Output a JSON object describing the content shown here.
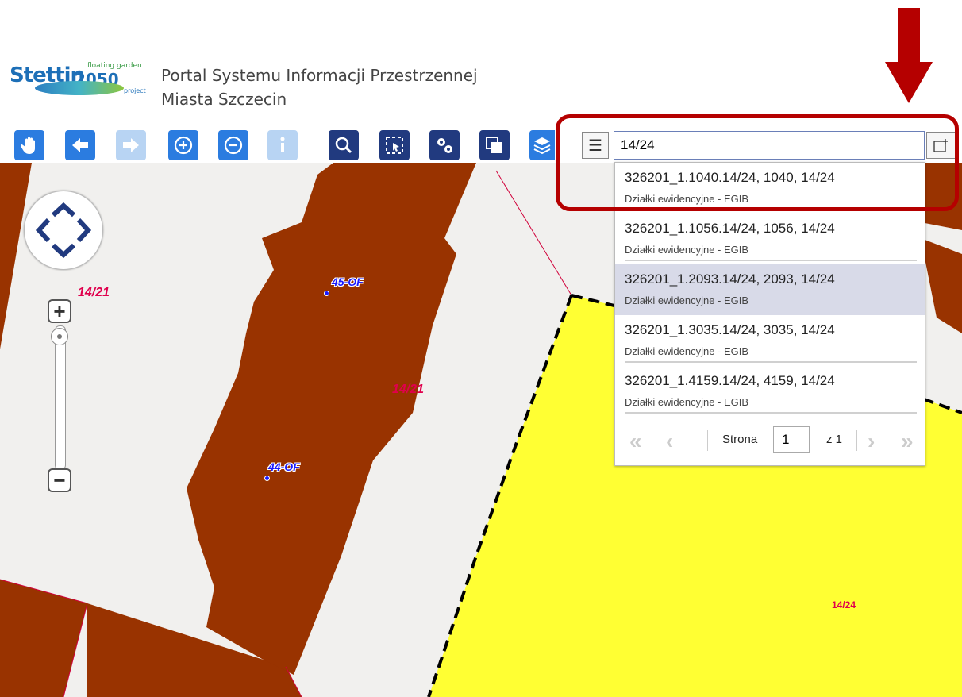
{
  "header": {
    "logo": {
      "name": "Stettin 2050",
      "text": "Stettin",
      "year": "2050",
      "tagline_top": "floating garden",
      "tagline_bottom": "project"
    },
    "title_line1": "Portal Systemu Informacji Przestrzennej",
    "title_line2": "Miasta Szczecin"
  },
  "toolbar": {
    "buttons": [
      {
        "name": "pan",
        "icon": "hand-icon"
      },
      {
        "name": "back",
        "icon": "arrow-left-icon"
      },
      {
        "name": "forward",
        "icon": "arrow-right-icon",
        "disabled": true
      },
      {
        "name": "zoom-in",
        "icon": "zoom-in-icon"
      },
      {
        "name": "zoom-out",
        "icon": "zoom-out-icon"
      },
      {
        "name": "info",
        "icon": "info-icon",
        "disabled": true
      },
      {
        "name": "search",
        "icon": "search-icon"
      },
      {
        "name": "select",
        "icon": "select-icon"
      },
      {
        "name": "tools",
        "icon": "gears-icon"
      },
      {
        "name": "windows",
        "icon": "windows-icon"
      },
      {
        "name": "layers",
        "icon": "layers-icon"
      }
    ],
    "colors": {
      "primary": "#2b7ce0",
      "dark": "#213a7f",
      "disabled": "#b8d4f3"
    }
  },
  "search": {
    "value": "14/24",
    "results": [
      {
        "title": "326201_1.1040.14/24, 1040, 14/24",
        "layer": "Działki ewidencyjne - EGIB"
      },
      {
        "title": "326201_1.1056.14/24, 1056, 14/24",
        "layer": "Działki ewidencyjne - EGIB"
      },
      {
        "title": "326201_1.2093.14/24, 2093, 14/24",
        "layer": "Działki ewidencyjne - EGIB",
        "selected": true
      },
      {
        "title": "326201_1.3035.14/24, 3035, 14/24",
        "layer": "Działki ewidencyjne - EGIB"
      },
      {
        "title": "326201_1.4159.14/24, 4159, 14/24",
        "layer": "Działki ewidencyjne - EGIB"
      }
    ],
    "pager": {
      "page_label": "Strona",
      "page_value": "1",
      "of_label": "z 1"
    }
  },
  "map": {
    "labels": {
      "parcel_a": "14/21",
      "parcel_b": "14/21",
      "parcel_c": "14/24",
      "point_a": "45-OF",
      "point_b": "44-OF"
    },
    "colors": {
      "building": "#993300",
      "parcel_highlight": "#ffff33",
      "background": "#f1f0ee",
      "parcel_label": "#e0004d",
      "point_label": "#1a1aff"
    }
  },
  "annotation": {
    "color": "#b50000"
  }
}
